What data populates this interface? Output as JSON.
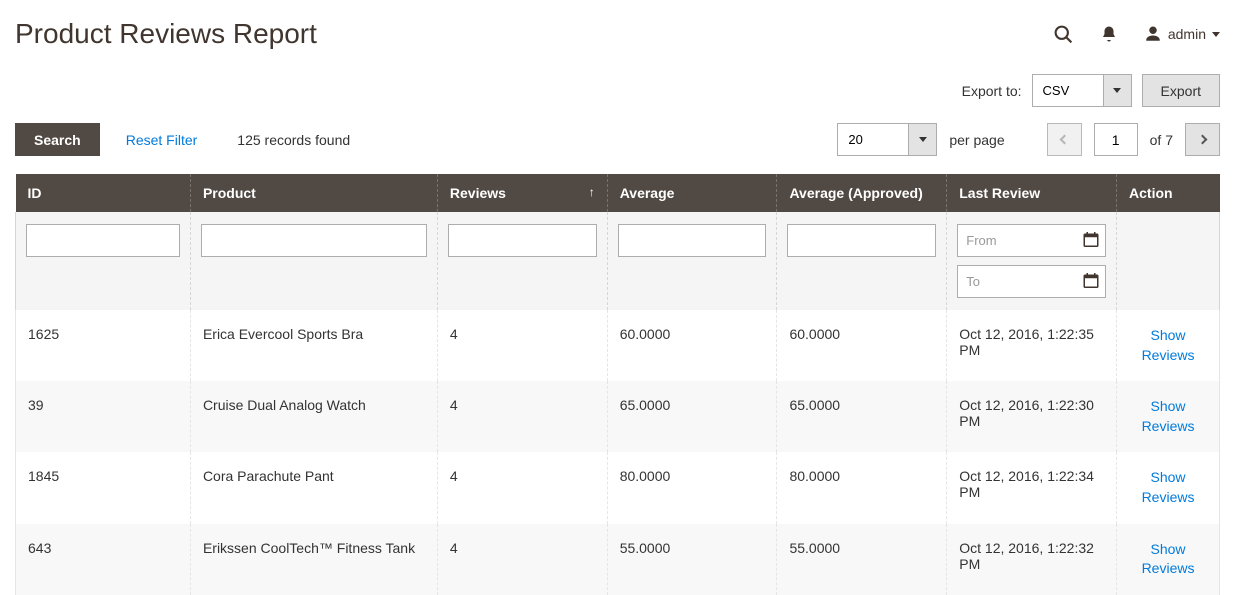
{
  "header": {
    "title": "Product Reviews Report",
    "admin_label": "admin"
  },
  "export": {
    "label": "Export to:",
    "selected": "CSV",
    "button": "Export"
  },
  "toolbar": {
    "search": "Search",
    "reset": "Reset Filter",
    "records": "125 records found",
    "per_page_value": "20",
    "per_page_label": "per page",
    "page_value": "1",
    "of_label": "of 7"
  },
  "columns": {
    "id": "ID",
    "product": "Product",
    "reviews": "Reviews",
    "average": "Average",
    "average_approved": "Average (Approved)",
    "last_review": "Last Review",
    "action": "Action"
  },
  "filters": {
    "from_placeholder": "From",
    "to_placeholder": "To"
  },
  "action_label": "Show Reviews",
  "rows": [
    {
      "id": "1625",
      "product": "Erica Evercool Sports Bra",
      "reviews": "4",
      "average": "60.0000",
      "average_approved": "60.0000",
      "last_review": "Oct 12, 2016, 1:22:35 PM"
    },
    {
      "id": "39",
      "product": "Cruise Dual Analog Watch",
      "reviews": "4",
      "average": "65.0000",
      "average_approved": "65.0000",
      "last_review": "Oct 12, 2016, 1:22:30 PM"
    },
    {
      "id": "1845",
      "product": "Cora Parachute Pant",
      "reviews": "4",
      "average": "80.0000",
      "average_approved": "80.0000",
      "last_review": "Oct 12, 2016, 1:22:34 PM"
    },
    {
      "id": "643",
      "product": "Erikssen CoolTech™ Fitness Tank",
      "reviews": "4",
      "average": "55.0000",
      "average_approved": "55.0000",
      "last_review": "Oct 12, 2016, 1:22:32 PM"
    }
  ]
}
